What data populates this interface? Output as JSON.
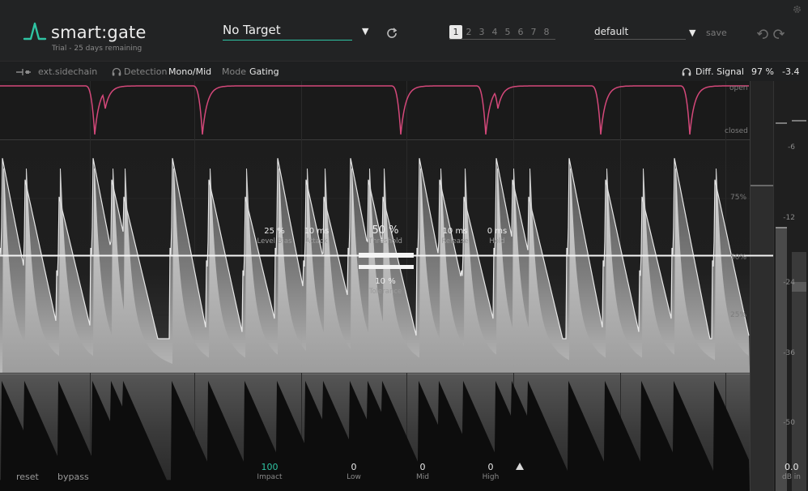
{
  "header": {
    "brand": "smart:gate",
    "trial": "Trial - 25 days remaining",
    "target": "No Target",
    "slots": [
      "1",
      "2",
      "3",
      "4",
      "5",
      "6",
      "7",
      "8"
    ],
    "active_slot": 0,
    "preset": "default",
    "save_label": "save",
    "accent": "#2fc4a3"
  },
  "subbar": {
    "ext_sidechain": "ext.sidechain",
    "detection_label": "Detection",
    "detection_value": "Mono/Mid",
    "mode_label": "Mode",
    "mode_value": "Gating",
    "diff_signal": "Diff. Signal",
    "percent": "97 %",
    "gain": "-3.4"
  },
  "gate_lane": {
    "open": "open",
    "closed": "closed",
    "color": "#d4487a"
  },
  "grid_labels": [
    "75%",
    "50%",
    "25%"
  ],
  "params": {
    "level_bias": {
      "value": "25 %",
      "name": "Level Bias"
    },
    "attack": {
      "value": "10 ms",
      "name": "Attack"
    },
    "threshold": {
      "value": "50 %",
      "name": "Threshold"
    },
    "release": {
      "value": "10 ms",
      "name": "Release"
    },
    "hold": {
      "value": "0 ms",
      "name": "Hold"
    },
    "tolerance": {
      "value": "10 %",
      "name": "Tolerance"
    }
  },
  "meter": {
    "ticks": [
      "-6",
      "-12",
      "-24",
      "-36",
      "-50"
    ],
    "value": "0.0",
    "unit": "dB in"
  },
  "bottom": {
    "reset": "reset",
    "bypass": "bypass",
    "bands": [
      {
        "value": "100",
        "name": "Impact",
        "accent": true
      },
      {
        "value": "0",
        "name": "Low"
      },
      {
        "value": "0",
        "name": "Mid"
      },
      {
        "value": "0",
        "name": "High"
      }
    ]
  }
}
